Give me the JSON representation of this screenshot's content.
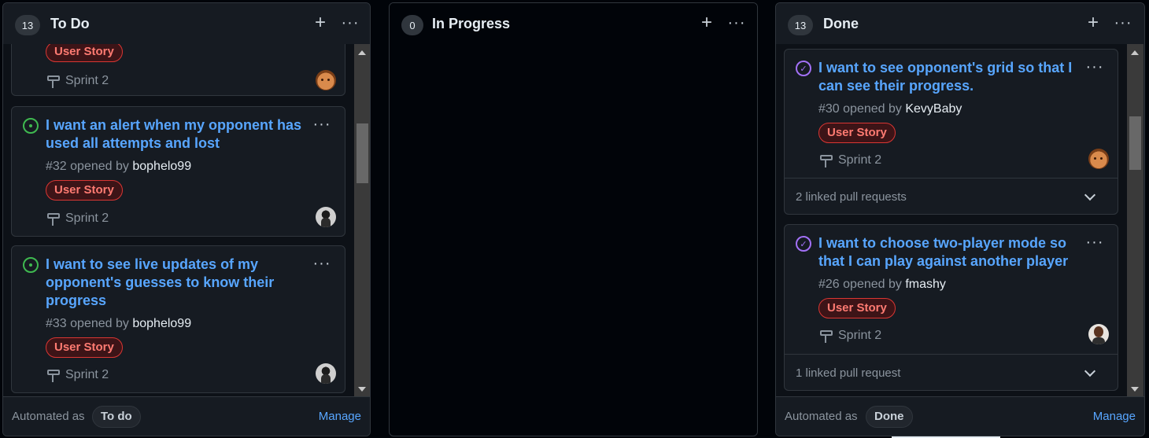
{
  "columns": {
    "todo": {
      "count": "13",
      "title": "To Do",
      "add_icon": "plus-icon",
      "more_icon": "kebab-horizontal-icon",
      "cards": [
        {
          "label": "User Story",
          "sprint": "Sprint 2",
          "avatar": "avatar-kevybaby"
        },
        {
          "title": "I want an alert when my opponent has used all attempts and lost",
          "number": "#32",
          "opened_by": "opened by",
          "author": "bophelo99",
          "label": "User Story",
          "sprint": "Sprint 2",
          "status_icon": "issue-opened-icon"
        },
        {
          "title": "I want to see live updates of my opponent's guesses to know their progress",
          "number": "#33",
          "opened_by": "opened by",
          "author": "bophelo99",
          "label": "User Story",
          "sprint": "Sprint 2",
          "status_icon": "issue-opened-icon"
        }
      ],
      "footer": {
        "automated_as": "Automated as",
        "automation": "To do",
        "manage": "Manage"
      }
    },
    "in_progress": {
      "count": "0",
      "title": "In Progress"
    },
    "done": {
      "count": "13",
      "title": "Done",
      "cards": [
        {
          "title": "I want to see opponent's grid so that I can see their progress.",
          "number": "#30",
          "opened_by": "opened by",
          "author": "KevyBaby",
          "label": "User Story",
          "sprint": "Sprint 2",
          "status_icon": "issue-closed-icon",
          "linked": "2 linked pull requests"
        },
        {
          "title": "I want to choose two-player mode so that I can play against another player",
          "number": "#26",
          "opened_by": "opened by",
          "author": "fmashy",
          "label": "User Story",
          "sprint": "Sprint 2",
          "status_icon": "issue-closed-icon",
          "linked": "1 linked pull request"
        }
      ],
      "footer": {
        "automated_as": "Automated as",
        "automation": "Done",
        "manage": "Manage"
      }
    }
  },
  "glyphs": {
    "plus": "+",
    "more": "···",
    "check": "✓"
  },
  "colors": {
    "link": "#58a6ff",
    "label_text": "#ff7b72",
    "label_border": "#da3633",
    "open": "#3fb950",
    "closed": "#a371f7",
    "background": "#010409"
  }
}
